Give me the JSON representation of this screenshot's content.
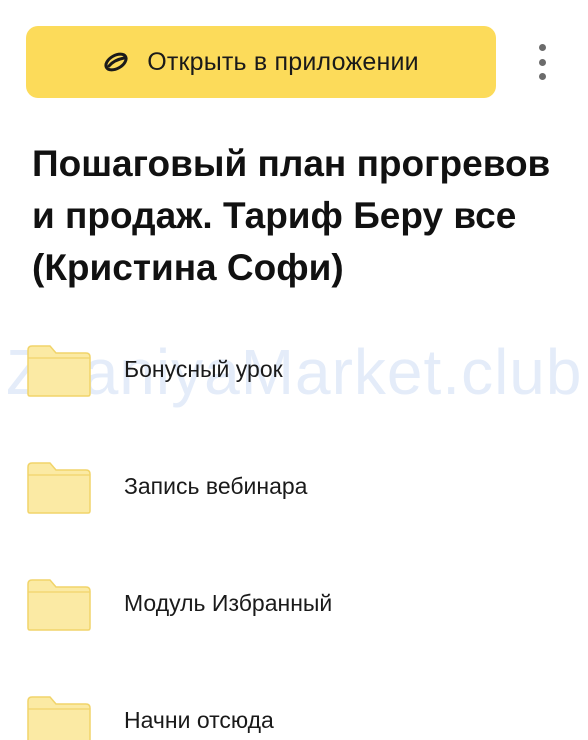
{
  "header": {
    "open_button_label": "Открыть в приложении",
    "open_icon": "yandex-disk-logo-icon",
    "more_icon": "more-vertical-icon",
    "accent_color": "#fcdb5a"
  },
  "folder": {
    "title": "Пошаговый план прогревов и продаж. Тариф Беру все (Кристина Софи)"
  },
  "watermark": "ZnaniyaMarket.club",
  "items": [
    {
      "name": "Бонусный урок",
      "icon": "folder-icon"
    },
    {
      "name": "Запись вебинара",
      "icon": "folder-icon"
    },
    {
      "name": "Модуль Избранный",
      "icon": "folder-icon"
    },
    {
      "name": "Начни отсюда",
      "icon": "folder-icon"
    }
  ]
}
